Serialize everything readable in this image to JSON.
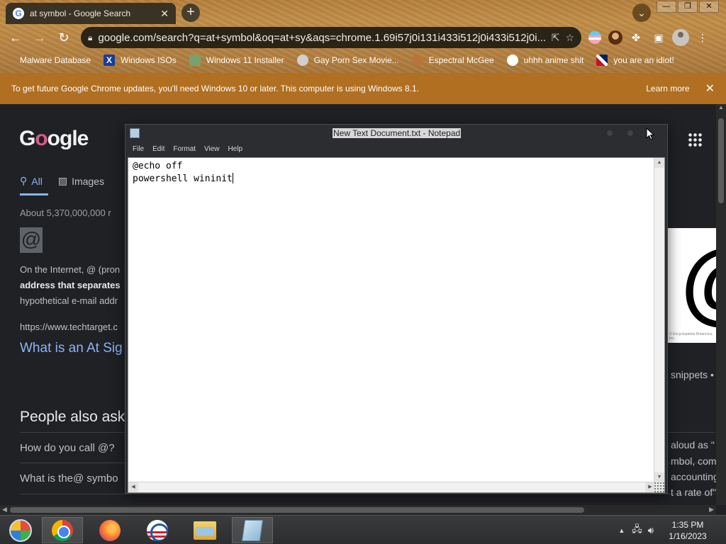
{
  "browser": {
    "tab_title": "at symbol - Google Search",
    "tab_close": "✕",
    "new_tab": "+",
    "tab_search": "⌄",
    "window_controls": [
      "—",
      "❐",
      "✕"
    ],
    "nav": {
      "back": "←",
      "forward": "→",
      "reload": "↻"
    },
    "url": "google.com/search?q=at+symbol&oq=at+sy&aqs=chrome.1.69i57j0i131i433i512j0i433i512j0i...",
    "omnibox_icons": [
      "share-icon",
      "star-icon"
    ],
    "toolbar_icons": [
      "trans-flag-extension-icon",
      "avatar-extension-icon",
      "puzzle-icon",
      "side-panel-icon",
      "profile-icon",
      "menu-icon"
    ],
    "bookmarks": [
      {
        "label": "Malware Database",
        "icon": "blank"
      },
      {
        "label": "Windows ISOs",
        "icon": "x-logo"
      },
      {
        "label": "Windows 11 Installer",
        "icon": "image"
      },
      {
        "label": "Gay Porn Sex Movie...",
        "icon": "cd"
      },
      {
        "label": "Espectral McGee",
        "icon": "face"
      },
      {
        "label": "uhhh anime shit",
        "icon": "anime"
      },
      {
        "label": "you are an idiot!",
        "icon": "uk-flag"
      }
    ]
  },
  "infobar": {
    "message": "To get future Google Chrome updates, you'll need Windows 10 or later. This computer is using Windows 8.1.",
    "action": "Learn more",
    "close": "✕"
  },
  "google": {
    "logo": "Google",
    "tabs": [
      {
        "label": "All",
        "icon": "search-icon"
      },
      {
        "label": "Images",
        "icon": "image-icon"
      }
    ],
    "results_count": "About 5,370,000,000 r",
    "thumb_symbol": "@",
    "snippet_line1": "On the Internet, @ (pron",
    "snippet_line2": "address that separates",
    "snippet_line3": "hypothetical e-mail addr",
    "source_url": "https://www.techtarget.c",
    "result_title": "What is an At Sig",
    "paa_heading": "People also ask",
    "paa_items": [
      "How do you call @?",
      "What is the@ symbo"
    ],
    "right_snippets": "snippets  •",
    "right_text_lines": [
      "aloud as \"",
      "mbol, comm",
      "accounting",
      "t a rate of\""
    ],
    "image_credit": "© Encyclopædia Britannica, Inc."
  },
  "notepad": {
    "title": "New Text Document.txt - Notepad",
    "menu": [
      "File",
      "Edit",
      "Format",
      "View",
      "Help"
    ],
    "content_line1": "@echo off",
    "content_line2": "powershell wininit"
  },
  "taskbar": {
    "apps": [
      "start-orb",
      "chrome",
      "firefox",
      "obama-logo",
      "file-explorer",
      "notepad"
    ],
    "time": "1:35 PM",
    "date": "1/16/2023"
  }
}
